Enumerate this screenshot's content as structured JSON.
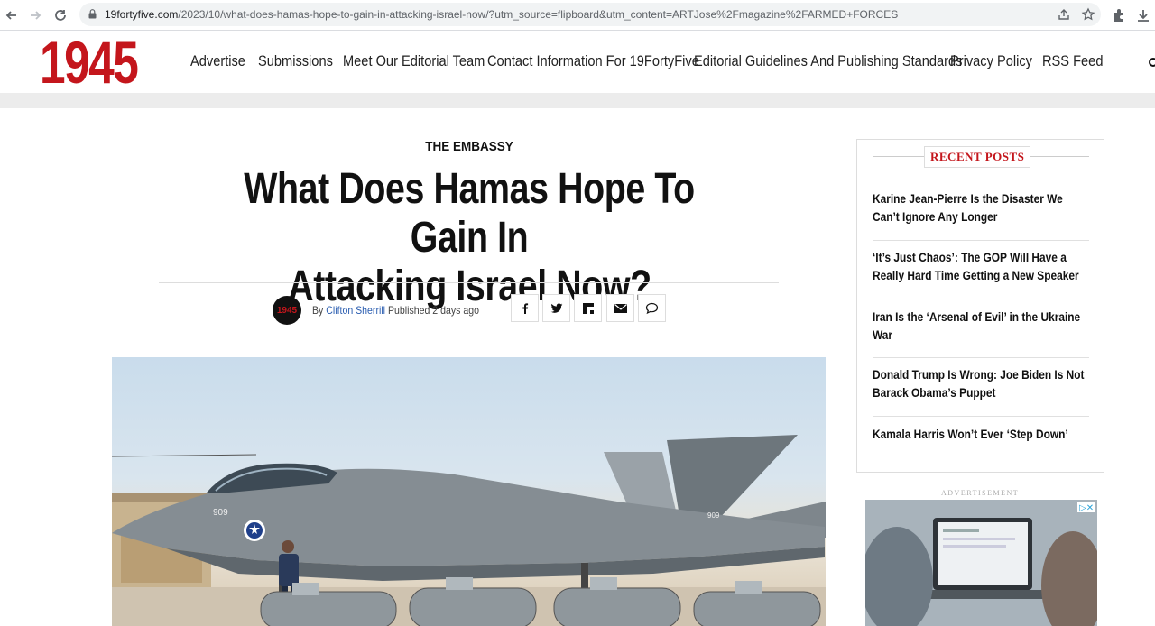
{
  "browser": {
    "url_domain": "19fortyfive.com",
    "url_path": "/2023/10/what-does-hamas-hope-to-gain-in-attacking-israel-now/?utm_source=flipboard&utm_content=ARTJose%2Fmagazine%2FARMED+FORCES"
  },
  "site": {
    "logo": "1945",
    "menu": [
      "Advertise",
      "Submissions",
      "Meet Our Editorial Team",
      "Contact Information For 19FortyFive",
      "Editorial Guidelines And Publishing Standards",
      "Privacy Policy",
      "RSS Feed"
    ]
  },
  "article": {
    "category": "THE EMBASSY",
    "title_line1": "What Does Hamas Hope To Gain In",
    "title_line2": "Attacking Israel Now?",
    "avatar_text": "1945",
    "by_label": "By",
    "author": "Clifton Sherrill",
    "published_label": "Published",
    "published_ago": "2 days ago",
    "share_icons": [
      "facebook-icon",
      "twitter-icon",
      "flipboard-icon",
      "email-icon",
      "comment-icon"
    ],
    "hero_jet_number": "909"
  },
  "sidebar": {
    "recent_title": "RECENT POSTS",
    "posts": [
      "Karine Jean-Pierre Is the Disaster We Can’t Ignore Any Longer",
      "‘It’s Just Chaos’: The GOP Will Have a Really Hard Time Getting a New Speaker",
      "Iran Is the ‘Arsenal of Evil’ in the Ukraine War",
      "Donald Trump Is Wrong: Joe Biden Is Not Barack Obama’s Puppet",
      "Kamala Harris Won’t Ever ‘Step Down’"
    ],
    "ad_label": "ADVERTISEMENT"
  },
  "colors": {
    "brand_red": "#c4161c",
    "author_link": "#2a5db0"
  }
}
